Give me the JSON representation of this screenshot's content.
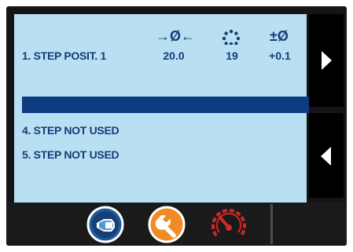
{
  "rows": [
    {
      "label": "1. STEP POSIT. 1",
      "diameter": "20.0",
      "count": "19",
      "tolerance": "+0.1"
    },
    {
      "label": "4. STEP NOT USED"
    },
    {
      "label": "5. STEP NOT USED"
    }
  ],
  "column_headers": {
    "diameter": "→Ø←",
    "count": "",
    "tolerance": "±Ø"
  },
  "icons": {
    "diameter_header": "diameter-symbol-icon",
    "count_header": "dotted-circle-icon",
    "tolerance_header": "tolerance-diameter-icon",
    "page_up": "chevron-right-icon",
    "page_down": "chevron-left-icon",
    "toolbar": [
      "tool-workpiece-icon",
      "wrench-icon",
      "speed-gauge-icon"
    ]
  },
  "colors": {
    "panel_background": "#b8e0f2",
    "text": "#183c78",
    "selection_bar": "#0d3c82",
    "screen_frame": "#151515",
    "wrench_button": "#f08c28",
    "gauge_red": "#d02828",
    "tool_button": "#1e5a9c"
  }
}
